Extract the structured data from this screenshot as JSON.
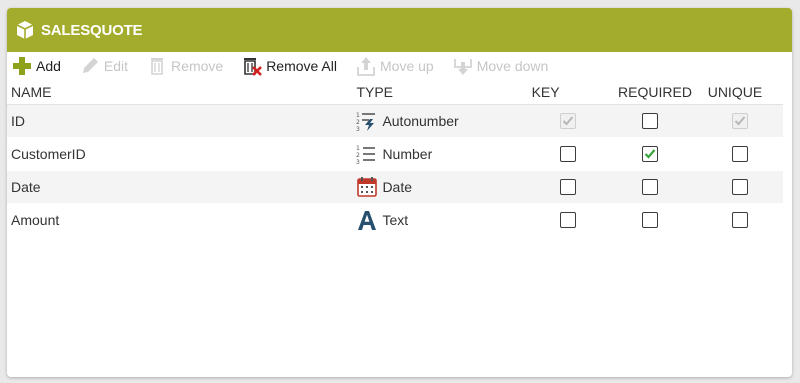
{
  "header": {
    "title": "SALESQUOTE",
    "icon": "cube-icon"
  },
  "toolbar": {
    "add_label": "Add",
    "edit_label": "Edit",
    "remove_label": "Remove",
    "remove_all_label": "Remove All",
    "move_up_label": "Move up",
    "move_down_label": "Move down"
  },
  "columns": {
    "name": "NAME",
    "type": "TYPE",
    "key": "KEY",
    "required": "REQUIRED",
    "unique": "UNIQUE"
  },
  "rows": [
    {
      "name": "ID",
      "type": "Autonumber",
      "type_icon": "autonumber-icon",
      "key": true,
      "key_disabled": true,
      "required": false,
      "unique": true,
      "unique_disabled": true
    },
    {
      "name": "CustomerID",
      "type": "Number",
      "type_icon": "number-icon",
      "key": false,
      "required": true,
      "unique": false
    },
    {
      "name": "Date",
      "type": "Date",
      "type_icon": "calendar-icon",
      "key": false,
      "required": false,
      "unique": false
    },
    {
      "name": "Amount",
      "type": "Text",
      "type_icon": "text-icon",
      "key": false,
      "required": false,
      "unique": false
    }
  ],
  "colors": {
    "header_bg": "#a3ac2c",
    "add_green": "#8ea31b",
    "check_green": "#3aa33a",
    "remove_red": "#d32020",
    "type_blue": "#27506e",
    "calendar_red": "#c0392b"
  }
}
